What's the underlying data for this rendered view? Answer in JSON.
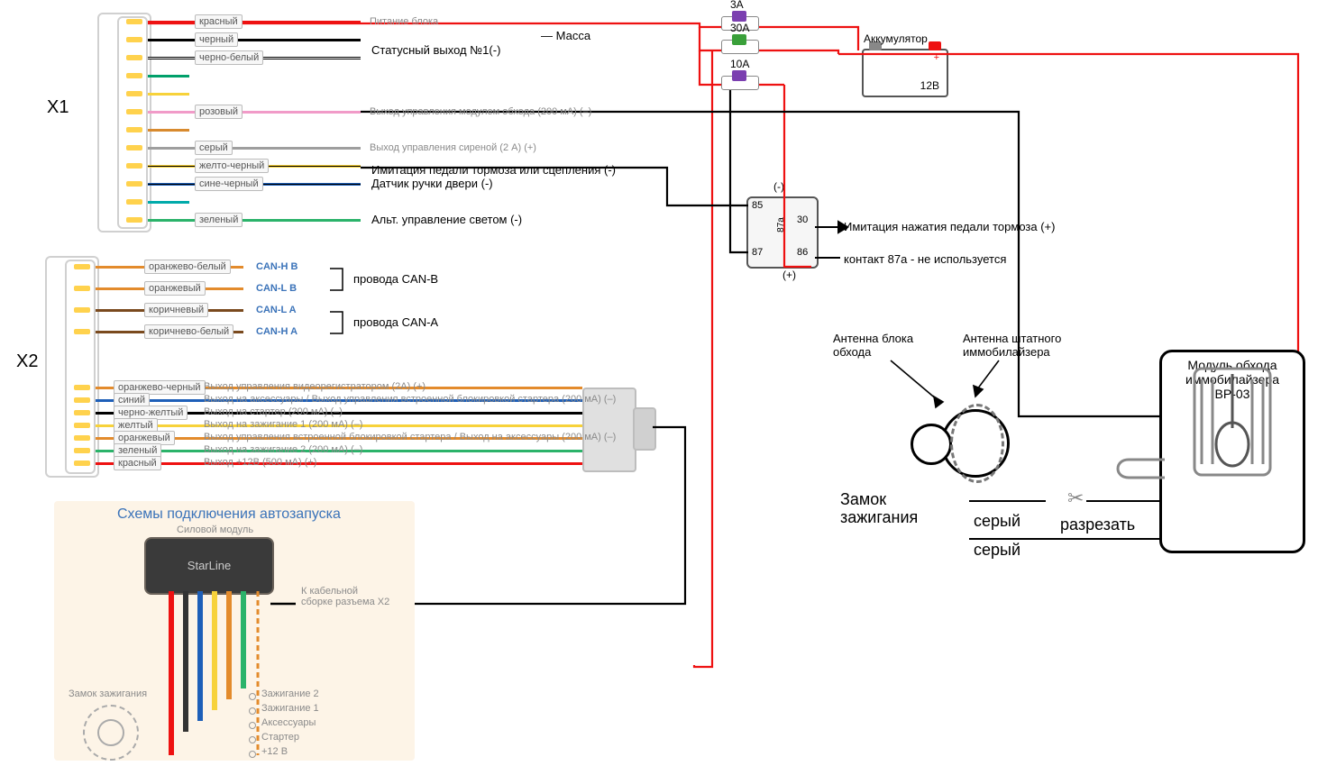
{
  "connectors": {
    "x1": {
      "name": "X1"
    },
    "x2": {
      "name": "X2"
    }
  },
  "x1_wires": [
    {
      "tag": "красный",
      "color": "#e11",
      "desc": "Питание блока",
      "func": ""
    },
    {
      "tag": "черный",
      "color": "#000",
      "desc": "",
      "func": "Масса"
    },
    {
      "tag": "черно-белый",
      "color": "#000",
      "stripe": "#fff",
      "desc": "",
      "func": "Статусный выход №1(-)"
    },
    {
      "tag": "",
      "color": "#00a06a",
      "desc": "",
      "func": ""
    },
    {
      "tag": "",
      "color": "#f7d23a",
      "desc": "",
      "func": ""
    },
    {
      "tag": "розовый",
      "color": "#f19bc8",
      "desc": "Выход управления модулем обхода (200 мА) (–)",
      "func": ""
    },
    {
      "tag": "",
      "color": "#d88a2e",
      "desc": "",
      "func": ""
    },
    {
      "tag": "серый",
      "color": "#9e9e9e",
      "desc": "Выход управления сиреной (2 А) (+)",
      "func": ""
    },
    {
      "tag": "желто-черный",
      "color": "#f7d23a",
      "stripe": "#000",
      "desc": "",
      "func": "Имитация педали тормоза или сцепления (-)"
    },
    {
      "tag": "сине-черный",
      "color": "#1e5fb8",
      "stripe": "#000",
      "desc": "",
      "func": "Датчик ручки двери (-)"
    },
    {
      "tag": "",
      "color": "#0aa",
      "desc": "",
      "func": ""
    },
    {
      "tag": "зеленый",
      "color": "#2bb36a",
      "desc": "",
      "func": "Альт. управление светом (-)"
    }
  ],
  "x2_top": [
    {
      "tag": "оранжево-белый",
      "color": "#e38b2c",
      "sig": "CAN-H B"
    },
    {
      "tag": "оранжевый",
      "color": "#e38b2c",
      "sig": "CAN-L B"
    },
    {
      "tag": "коричневый",
      "color": "#7a4a1e",
      "sig": "CAN-L A"
    },
    {
      "tag": "коричнево-белый",
      "color": "#7a4a1e",
      "sig": "CAN-H A"
    }
  ],
  "can_groups": {
    "b": "провода CAN-B",
    "a": "провода CAN-A"
  },
  "x2_bottom": [
    {
      "tag": "оранжево-черный",
      "color": "#e38b2c",
      "desc": "Выход управления видеорегистратором (2А) (+)"
    },
    {
      "tag": "синий",
      "color": "#1e5fb8",
      "desc": "Выход на аксессуары / Выход управления встроенной блокировкой стартера (200 мА) (–)"
    },
    {
      "tag": "черно-желтый",
      "color": "#000",
      "desc": "Выход на стартер (200 мА) (–)"
    },
    {
      "tag": "желтый",
      "color": "#f7d23a",
      "desc": "Выход на зажигание 1 (200 мА) (–)"
    },
    {
      "tag": "оранжевый",
      "color": "#e38b2c",
      "desc": "Выход управления встроенной блокировкой стартера / Выход на аксессуары (200 мА) (–)"
    },
    {
      "tag": "зеленый",
      "color": "#2bb36a",
      "desc": "Выход на зажигание 2 (200 мА) (–)"
    },
    {
      "tag": "красный",
      "color": "#e11",
      "desc": "Выход +12В (500 мА) (+)"
    }
  ],
  "fuses": [
    {
      "label": "3А",
      "color": "#7b3fb0",
      "y": 22
    },
    {
      "label": "30А",
      "color": "#3aa03a",
      "y": 48
    },
    {
      "label": "10А",
      "color": "#7b3fb0",
      "y": 88
    }
  ],
  "battery": {
    "label": "Аккумулятор",
    "voltage": "12В"
  },
  "relay": {
    "pins": {
      "p85": "85",
      "p30": "30",
      "p87": "87",
      "p87a": "87а",
      "p86": "86"
    },
    "minus": "(-)",
    "plus": "(+)",
    "text_press": "Имитация нажатия педали тормоза (+)",
    "text_87a": "контакт 87а - не используется"
  },
  "ignition": {
    "lock": "Замок зажигания",
    "ant_bypass": "Антенна блока обхода",
    "ant_stock": "Антенна штатного иммобилайзера",
    "gray": "серый",
    "cut": "разрезать"
  },
  "bypass": {
    "title": "Модуль обхода иммобилайзера",
    "model": "BP-03"
  },
  "autostart": {
    "title": "Схемы подключения автозапуска",
    "power_module": "Силовой модуль",
    "brand": "StarLine",
    "to_x2": "К кабельной сборке разъема X2",
    "lock": "Замок зажигания",
    "legend": [
      "Зажигание 2",
      "Зажигание 1",
      "Аксессуары",
      "Стартер",
      "+12 В"
    ]
  }
}
